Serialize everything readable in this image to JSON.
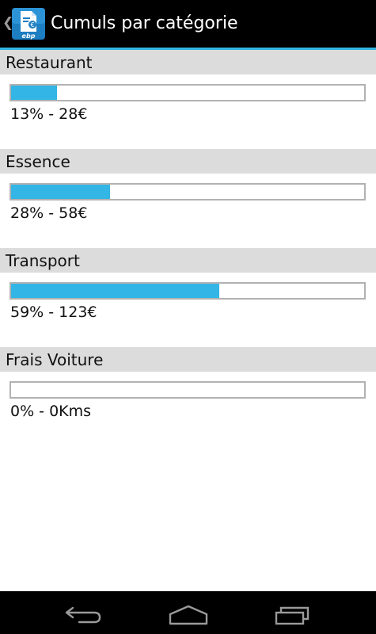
{
  "app": {
    "title": "Cumuls par catégorie",
    "icon_name": "ebp-document-euro-icon",
    "icon_label": "ebp"
  },
  "colors": {
    "accent": "#33b5e5",
    "header_background": "#dcdcdc",
    "action_bar": "#000000"
  },
  "categories": [
    {
      "name": "Restaurant",
      "percent": 13,
      "summary": "13% - 28€"
    },
    {
      "name": "Essence",
      "percent": 28,
      "summary": "28% - 58€"
    },
    {
      "name": "Transport",
      "percent": 59,
      "summary": "59% - 123€"
    },
    {
      "name": "Frais Voiture",
      "percent": 0,
      "summary": "0% - 0Kms"
    }
  ],
  "navigation": {
    "buttons": [
      "back-icon",
      "home-icon",
      "recent-apps-icon"
    ]
  }
}
